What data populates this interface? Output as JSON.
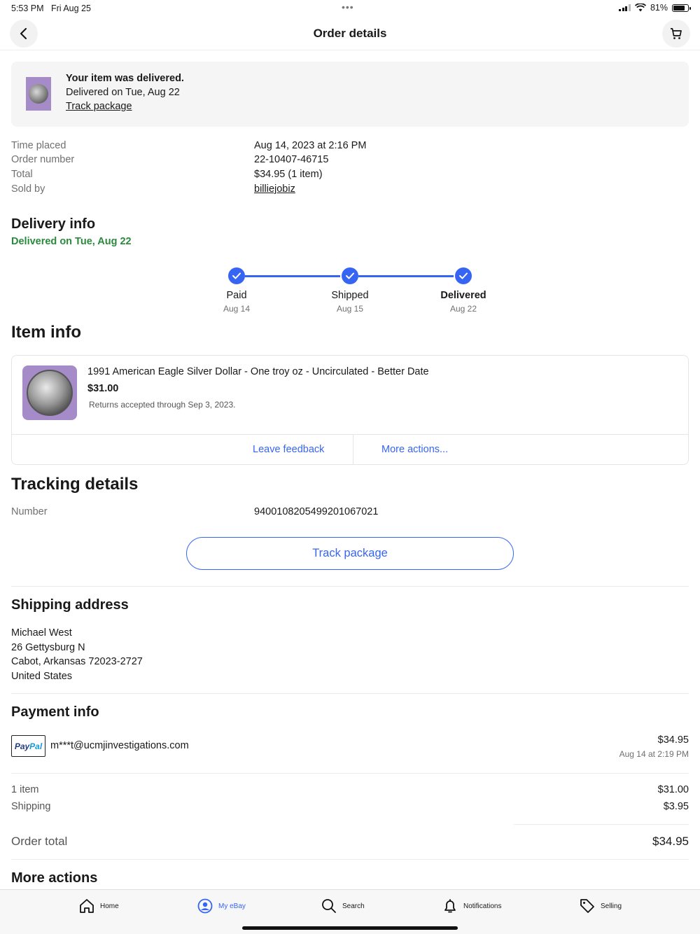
{
  "status_bar": {
    "time": "5:53 PM",
    "date": "Fri Aug 25",
    "battery": "81%",
    "battery_level": 0.81
  },
  "nav": {
    "title": "Order details"
  },
  "banner": {
    "title": "Your item was delivered.",
    "subtitle": "Delivered on Tue, Aug 22",
    "link": "Track package"
  },
  "order": [
    {
      "label": "Time placed",
      "value": "Aug 14, 2023 at 2:16 PM"
    },
    {
      "label": "Order number",
      "value": "22-10407-46715"
    },
    {
      "label": "Total",
      "value": "$34.95 (1 item)"
    },
    {
      "label": "Sold by",
      "value": "billiejobiz"
    }
  ],
  "delivery": {
    "heading": "Delivery info",
    "status": "Delivered on Tue, Aug 22",
    "steps": [
      {
        "label": "Paid",
        "date": "Aug 14"
      },
      {
        "label": "Shipped",
        "date": "Aug 15"
      },
      {
        "label": "Delivered",
        "date": "Aug 22"
      }
    ]
  },
  "item_info": {
    "heading": "Item info",
    "name": "1991 American Eagle Silver Dollar - One troy oz - Uncirculated - Better Date",
    "price": "$31.00",
    "returns": "Returns accepted through Sep 3, 2023.",
    "actions": [
      "Leave feedback",
      "More actions..."
    ]
  },
  "tracking": {
    "heading": "Tracking details",
    "number_label": "Number",
    "number": "9400108205499201067021",
    "button": "Track package"
  },
  "shipping": {
    "heading": "Shipping address",
    "lines": [
      "Michael West",
      "26 Gettysburg N",
      "Cabot, Arkansas 72023-2727",
      "United States"
    ]
  },
  "payment": {
    "heading": "Payment info",
    "logo_a": "Pay",
    "logo_b": "Pal",
    "email": "m***t@ucmjinvestigations.com",
    "amount": "$34.95",
    "date": "Aug 14 at 2:19 PM",
    "items_label": "1 item",
    "items_value": "$31.00",
    "shipping_label": "Shipping",
    "shipping_value": "$3.95",
    "total_label": "Order total",
    "total_value": "$34.95"
  },
  "more_actions": {
    "heading": "More actions"
  },
  "tabbar": [
    "Home",
    "My eBay",
    "Search",
    "Notifications",
    "Selling"
  ],
  "colors": {
    "accent": "#3665f3",
    "delivered_green": "#2a8a3c"
  }
}
